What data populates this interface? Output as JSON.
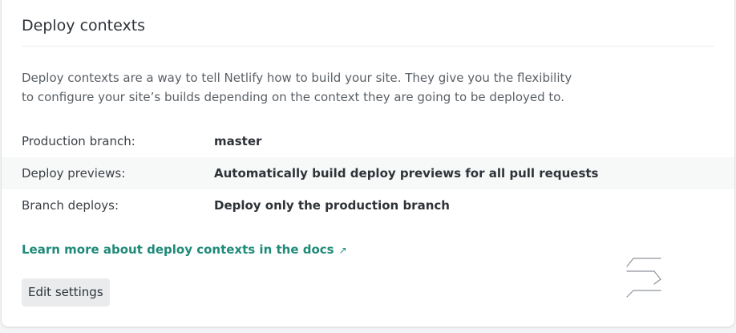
{
  "card": {
    "title": "Deploy contexts",
    "description": "Deploy contexts are a way to tell Netlify how to build your site. They give you the flexibility to configure your site’s builds depending on the context they are going to be deployed to."
  },
  "settings": [
    {
      "label": "Production branch:",
      "value": "master"
    },
    {
      "label": "Deploy previews:",
      "value": "Automatically build deploy previews for all pull requests"
    },
    {
      "label": "Branch deploys:",
      "value": "Deploy only the production branch"
    }
  ],
  "docs_link": {
    "label": "Learn more about deploy contexts in the docs",
    "icon": "external-link-icon",
    "color": "#1e8a78"
  },
  "actions": {
    "edit_label": "Edit settings"
  },
  "icons": {
    "decorative_mark": "stacked-lines-icon"
  }
}
